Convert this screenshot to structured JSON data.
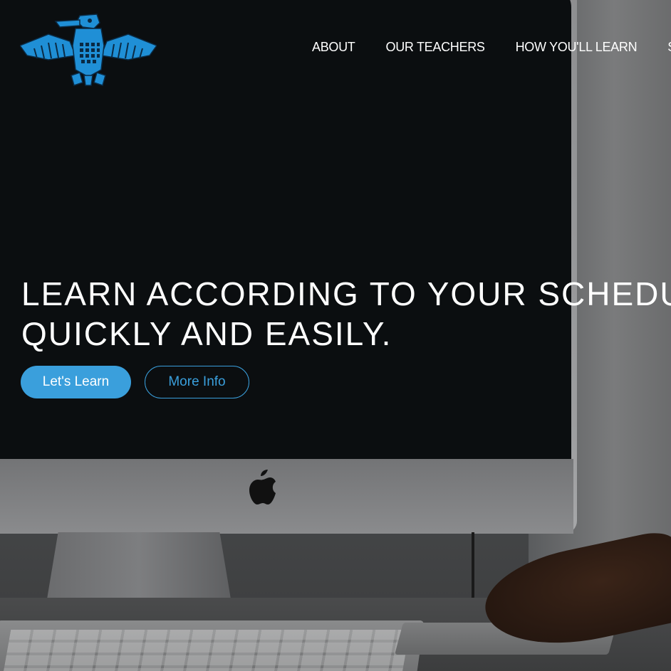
{
  "header": {
    "logo_icon": "thunderbird-icon",
    "nav": [
      {
        "label": "ABOUT"
      },
      {
        "label": "OUR TEACHERS"
      },
      {
        "label": "HOW YOU'LL LEARN"
      },
      {
        "label": "S"
      }
    ]
  },
  "hero": {
    "headline_line1": "LEARN ACCORDING TO YOUR SCHEDU",
    "headline_line2": "QUICKLY AND EASILY.",
    "primary_button": "Let's Learn",
    "secondary_button": "More Info"
  },
  "colors": {
    "accent": "#3a9fdc",
    "logo_blue": "#1f8fd6",
    "text": "#ffffff"
  }
}
